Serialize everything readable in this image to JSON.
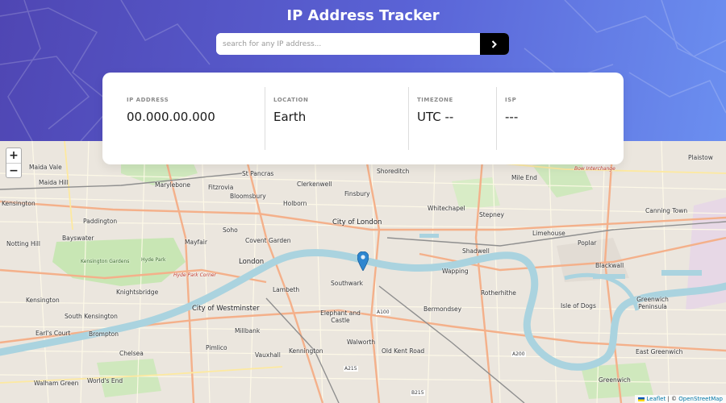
{
  "header": {
    "title": "IP Address Tracker",
    "search_placeholder": "search for any IP address...",
    "submit_icon": "chevron-right-icon"
  },
  "info": [
    {
      "label": "IP ADDRESS",
      "value": "00.000.00.000"
    },
    {
      "label": "LOCATION",
      "value": "Earth"
    },
    {
      "label": "TIMEZONE",
      "value": "UTC --"
    },
    {
      "label": "ISP",
      "value": "---"
    }
  ],
  "map": {
    "zoom_in": "+",
    "zoom_out": "−",
    "labels": {
      "maida_vale": "Maida Vale",
      "maida_hill": "Maida Hill",
      "kensington_n": "Kensington",
      "paddington": "Paddington",
      "notting_hill": "Notting Hill",
      "bayswater": "Bayswater",
      "marylebone": "Marylebone",
      "fitzrovia": "Fitzrovia",
      "st_pancras": "St Pancras",
      "bloomsbury": "Bloomsbury",
      "clerkenwell": "Clerkenwell",
      "finsbury": "Finsbury",
      "shoreditch": "Shoreditch",
      "holborn": "Holborn",
      "soho": "Soho",
      "mayfair": "Mayfair",
      "covent_garden": "Covent Garden",
      "city_of_london": "City of London",
      "whitechapel": "Whitechapel",
      "stepney": "Stepney",
      "mile_end": "Mile End",
      "bow_interchange": "Bow Interchange",
      "plaistow": "Plaistow",
      "canning_town": "Canning Town",
      "limehouse": "Limehouse",
      "poplar": "Poplar",
      "blackwall": "Blackwall",
      "london": "London",
      "kensington_gardens": "Kensington Gardens",
      "hyde_park": "Hyde Park",
      "hyde_park_corner": "Hyde Park Corner",
      "knightsbridge": "Knightsbridge",
      "shadwell": "Shadwell",
      "wapping": "Wapping",
      "lambeth": "Lambeth",
      "southwark": "Southwark",
      "city_of_westminster": "City of Westminster",
      "kensington_s": "Kensington",
      "south_kensington": "South Kensington",
      "earls_court": "Earl's Court",
      "brompton": "Brompton",
      "millbank": "Millbank",
      "elephant_castle": "Elephant and Castle",
      "bermondsey": "Bermondsey",
      "rotherhithe": "Rotherhithe",
      "isle_of_dogs": "Isle of Dogs",
      "greenwich_peninsula": "Greenwich Peninsula",
      "chelsea": "Chelsea",
      "pimlico": "Pimlico",
      "vauxhall": "Vauxhall",
      "kennington": "Kennington",
      "walworth": "Walworth",
      "old_kent_road": "Old Kent Road",
      "east_greenwich": "East Greenwich",
      "walham_green": "Walham Green",
      "worlds_end": "World's End",
      "greenwich": "Greenwich",
      "a100": "A100",
      "a200": "A200",
      "a215": "A215",
      "b215": "B215"
    },
    "attribution": {
      "leaflet": "Leaflet",
      "separator": " | © ",
      "osm": "OpenStreetMap"
    }
  },
  "colors": {
    "header_start": "#4f46b3",
    "header_end": "#6b8ff0",
    "river": "#aad3df",
    "park": "#c8e6b4",
    "road_major": "#f4b08a",
    "road_minor": "#fff7c4",
    "marker": "#2e86cf"
  }
}
